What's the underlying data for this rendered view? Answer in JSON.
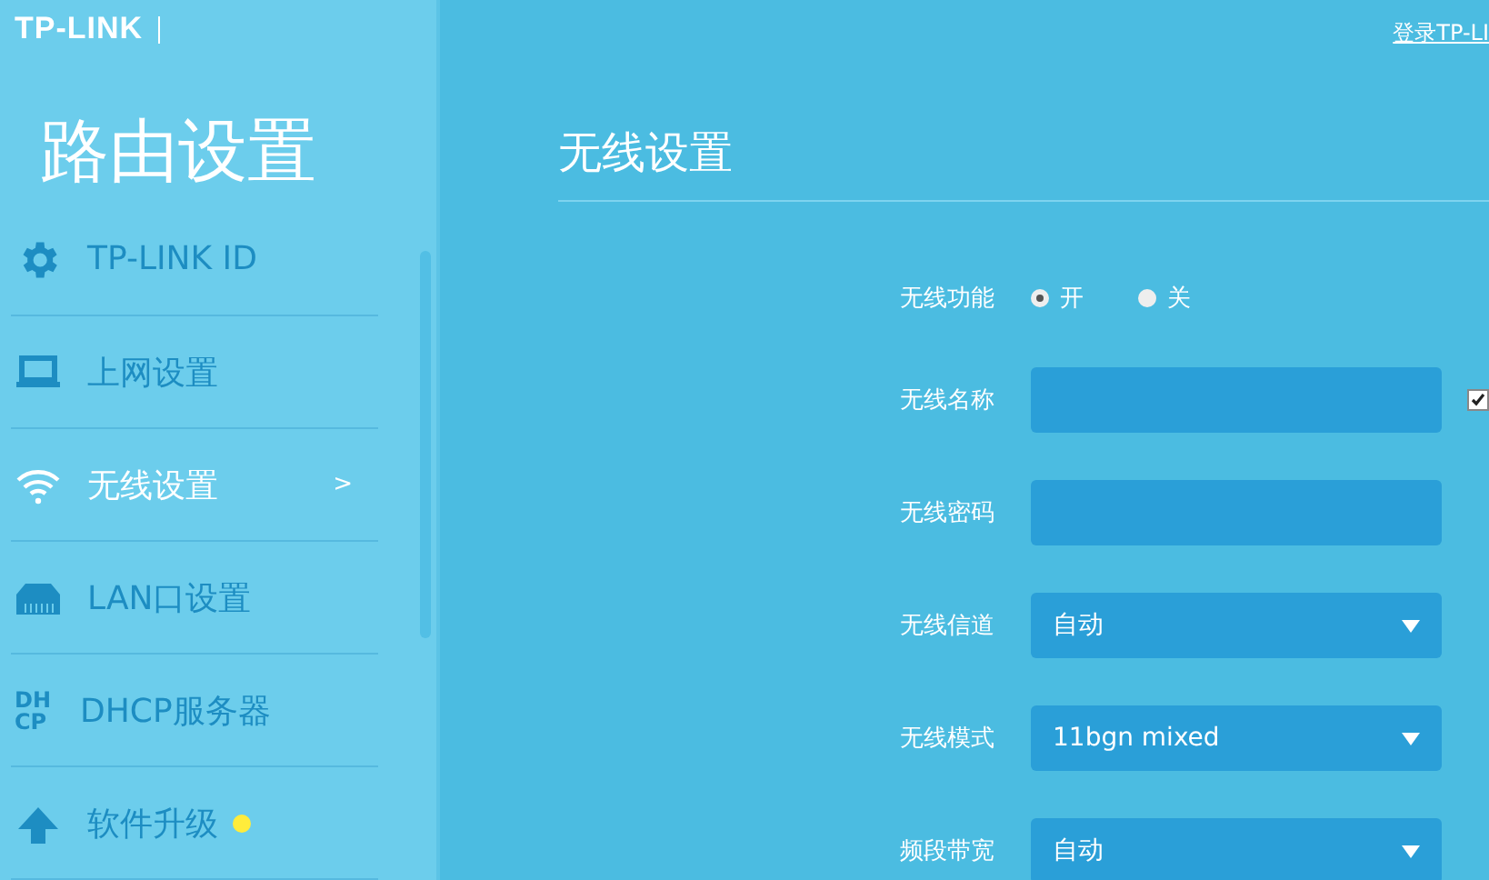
{
  "brand": {
    "logo": "TP-LINK"
  },
  "top_link": "登录TP-LI",
  "sidebar": {
    "title": "路由设置",
    "items": [
      {
        "label": "TP-LINK ID",
        "kind": "gear",
        "selected": false,
        "badge": false
      },
      {
        "label": "上网设置",
        "kind": "laptop",
        "selected": false,
        "badge": false
      },
      {
        "label": "无线设置",
        "kind": "wifi",
        "selected": true,
        "badge": false,
        "arrow": ">"
      },
      {
        "label": "LAN口设置",
        "kind": "lan",
        "selected": false,
        "badge": false
      },
      {
        "label": "DHCP服务器",
        "kind": "text_icon",
        "icon_lines": [
          "DH",
          "CP"
        ],
        "selected": false,
        "badge": false
      },
      {
        "label": "软件升级",
        "kind": "upload",
        "selected": false,
        "badge": true
      }
    ]
  },
  "main": {
    "heading": "无线设置",
    "fields": [
      {
        "kind": "radio",
        "label": "无线功能",
        "options": [
          {
            "label": "开",
            "selected": true
          },
          {
            "label": "关",
            "selected": false
          }
        ]
      },
      {
        "kind": "text",
        "label": "无线名称",
        "checkbox": {
          "checked": true
        }
      },
      {
        "kind": "text",
        "label": "无线密码"
      },
      {
        "kind": "select",
        "label": "无线信道",
        "value": "自动"
      },
      {
        "kind": "select",
        "label": "无线模式",
        "value": "11bgn mixed"
      },
      {
        "kind": "select",
        "label": "频段带宽",
        "value": "自动"
      }
    ]
  }
}
